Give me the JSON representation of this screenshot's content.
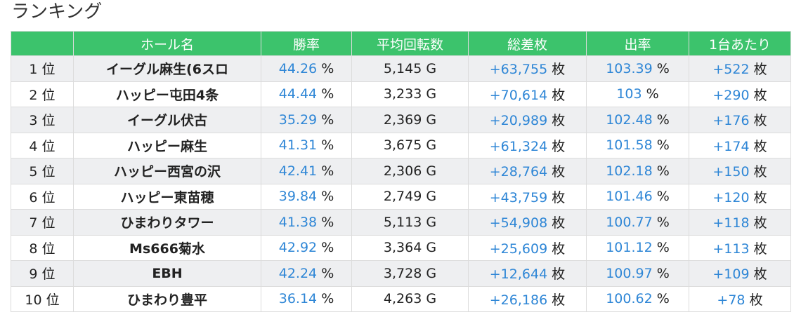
{
  "title": "ランキング",
  "headers": [
    "",
    "ホール名",
    "勝率",
    "平均回転数",
    "総差枚",
    "出率",
    "1台あたり"
  ],
  "rows": [
    {
      "rank": "1 位",
      "hall": "イーグル麻生(6スロ",
      "win_rate": "44.26",
      "win_rate_unit": "%",
      "avg_spins": "5,145 G",
      "total_diff": "+63,755",
      "total_diff_unit": "枚",
      "payout": "103.39",
      "payout_unit": "%",
      "per_unit": "+522",
      "per_unit_unit": "枚"
    },
    {
      "rank": "2 位",
      "hall": "ハッピー屯田4条",
      "win_rate": "44.44",
      "win_rate_unit": "%",
      "avg_spins": "3,233 G",
      "total_diff": "+70,614",
      "total_diff_unit": "枚",
      "payout": "103",
      "payout_unit": "%",
      "per_unit": "+290",
      "per_unit_unit": "枚"
    },
    {
      "rank": "3 位",
      "hall": "イーグル伏古",
      "win_rate": "35.29",
      "win_rate_unit": "%",
      "avg_spins": "2,369 G",
      "total_diff": "+20,989",
      "total_diff_unit": "枚",
      "payout": "102.48",
      "payout_unit": "%",
      "per_unit": "+176",
      "per_unit_unit": "枚"
    },
    {
      "rank": "4 位",
      "hall": "ハッピー麻生",
      "win_rate": "41.31",
      "win_rate_unit": "%",
      "avg_spins": "3,675 G",
      "total_diff": "+61,324",
      "total_diff_unit": "枚",
      "payout": "101.58",
      "payout_unit": "%",
      "per_unit": "+174",
      "per_unit_unit": "枚"
    },
    {
      "rank": "5 位",
      "hall": "ハッピー西宮の沢",
      "win_rate": "42.41",
      "win_rate_unit": "%",
      "avg_spins": "2,306 G",
      "total_diff": "+28,764",
      "total_diff_unit": "枚",
      "payout": "102.18",
      "payout_unit": "%",
      "per_unit": "+150",
      "per_unit_unit": "枚"
    },
    {
      "rank": "6 位",
      "hall": "ハッピー東苗穂",
      "win_rate": "39.84",
      "win_rate_unit": "%",
      "avg_spins": "2,749 G",
      "total_diff": "+43,759",
      "total_diff_unit": "枚",
      "payout": "101.46",
      "payout_unit": "%",
      "per_unit": "+120",
      "per_unit_unit": "枚"
    },
    {
      "rank": "7 位",
      "hall": "ひまわりタワー",
      "win_rate": "41.38",
      "win_rate_unit": "%",
      "avg_spins": "5,113 G",
      "total_diff": "+54,908",
      "total_diff_unit": "枚",
      "payout": "100.77",
      "payout_unit": "%",
      "per_unit": "+118",
      "per_unit_unit": "枚"
    },
    {
      "rank": "8 位",
      "hall": "Ms666菊水",
      "win_rate": "42.92",
      "win_rate_unit": "%",
      "avg_spins": "3,364 G",
      "total_diff": "+25,609",
      "total_diff_unit": "枚",
      "payout": "101.12",
      "payout_unit": "%",
      "per_unit": "+113",
      "per_unit_unit": "枚"
    },
    {
      "rank": "9 位",
      "hall": "EBH",
      "win_rate": "42.24",
      "win_rate_unit": "%",
      "avg_spins": "3,728 G",
      "total_diff": "+12,644",
      "total_diff_unit": "枚",
      "payout": "100.97",
      "payout_unit": "%",
      "per_unit": "+109",
      "per_unit_unit": "枚"
    },
    {
      "rank": "10 位",
      "hall": "ひまわり豊平",
      "win_rate": "36.14",
      "win_rate_unit": "%",
      "avg_spins": "4,263 G",
      "total_diff": "+26,186",
      "total_diff_unit": "枚",
      "payout": "100.62",
      "payout_unit": "%",
      "per_unit": "+78",
      "per_unit_unit": "枚"
    }
  ],
  "colors": {
    "header_bg": "#3cc36c",
    "header_text": "#ffffff",
    "value_blue": "#2e86d6",
    "stripe": "#eeeff1"
  }
}
